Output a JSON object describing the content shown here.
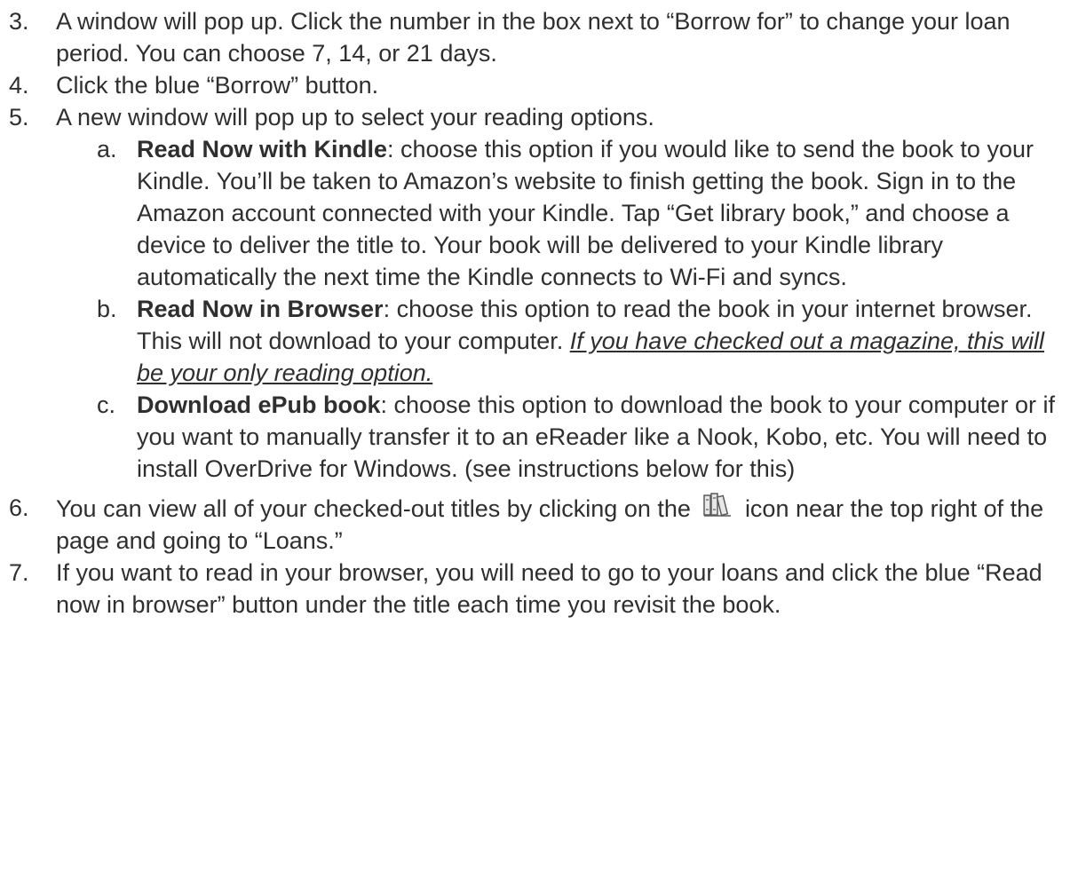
{
  "steps": [
    {
      "num": "3.",
      "text": "A window will pop up. Click the number in the box next to “Borrow for” to change your loan period. You can choose 7, 14, or 21 days."
    },
    {
      "num": "4.",
      "text": "Click the blue “Borrow” button."
    },
    {
      "num": "5.",
      "text": "A new window will pop up to select your reading options."
    },
    {
      "num": "6.",
      "text_before": "You can view all of your checked-out titles by clicking on the",
      "text_after": "icon near the top right of the page and going to “Loans.”",
      "icon": "library-shelf-icon"
    },
    {
      "num": "7.",
      "text": "If you want to read in your browser, you will need to go to your loans and click the blue “Read now in browser” button under the title each time you revisit the book."
    }
  ],
  "options": [
    {
      "letter": "a.",
      "title": "Read Now with Kindle",
      "text": ": choose this option if you would like to send the book to your Kindle. You’ll be taken to Amazon’s website to finish getting the book. Sign in to the Amazon account connected with your Kindle. Tap “Get library book,” and choose a device to deliver the title to. Your book will be delivered to your Kindle library automatically the next time the Kindle connects to Wi-Fi and syncs."
    },
    {
      "letter": "b.",
      "title": "Read Now in Browser",
      "text": ": choose this option to read the book in your internet browser. This will not download to your computer. ",
      "note": "If you have checked out a magazine, this will be your only reading option."
    },
    {
      "letter": "c.",
      "title": "Download ePub book",
      "text": ": choose this option to download the book to your computer or if you want to manually transfer it to an eReader like a Nook, Kobo, etc. You will need to install OverDrive for Windows. (see instructions below for this)"
    }
  ]
}
